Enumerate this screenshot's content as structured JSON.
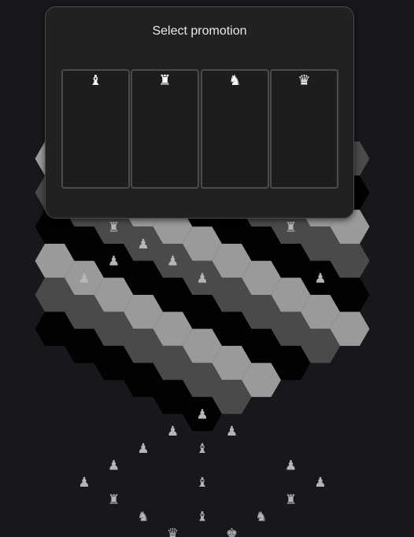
{
  "promotion": {
    "title": "Select promotion",
    "options": [
      {
        "piece": "bishop",
        "glyph": "♝"
      },
      {
        "piece": "rook",
        "glyph": "♜"
      },
      {
        "piece": "knight",
        "glyph": "♞"
      },
      {
        "piece": "queen",
        "glyph": "♛"
      }
    ]
  },
  "board": {
    "colors": {
      "light": "#9a9a9a",
      "mid": "#4a4a4a",
      "dark": "#020202"
    },
    "piece_color": "#b5b5b5",
    "pieces": [
      {
        "piece": "rook",
        "glyph": "♜",
        "col": -3,
        "row": -2
      },
      {
        "piece": "rook",
        "glyph": "♜",
        "col": 3,
        "row": -2
      },
      {
        "piece": "pawn",
        "glyph": "♟",
        "col": -4,
        "row": -1
      },
      {
        "piece": "bishop",
        "glyph": "♝",
        "col": 0,
        "row": -1
      },
      {
        "piece": "pawn",
        "glyph": "♟",
        "col": 4,
        "row": -1
      },
      {
        "piece": "pawn",
        "glyph": "♟",
        "col": -3,
        "row": -1
      },
      {
        "piece": "pawn",
        "glyph": "♟",
        "col": -2,
        "row": -1
      },
      {
        "piece": "pawn",
        "glyph": "♟",
        "col": -1,
        "row": 0
      },
      {
        "piece": "pawn",
        "glyph": "♟",
        "col": 0,
        "row": 1
      },
      {
        "piece": "pawn",
        "glyph": "♟",
        "col": 0,
        "row": 5
      },
      {
        "piece": "pawn",
        "glyph": "♟",
        "col": -1,
        "row": 5
      },
      {
        "piece": "pawn",
        "glyph": "♟",
        "col": 1,
        "row": 5
      },
      {
        "piece": "pawn",
        "glyph": "♟",
        "col": -2,
        "row": 5
      },
      {
        "piece": "pawn",
        "glyph": "♟",
        "col": -3,
        "row": 5
      },
      {
        "piece": "pawn",
        "glyph": "♟",
        "col": 3,
        "row": 5
      },
      {
        "piece": "pawn",
        "glyph": "♟",
        "col": -4,
        "row": 5
      },
      {
        "piece": "pawn",
        "glyph": "♟",
        "col": 4,
        "row": 5
      },
      {
        "piece": "rook",
        "glyph": "♜",
        "col": -3,
        "row": 6
      },
      {
        "piece": "rook",
        "glyph": "♜",
        "col": 3,
        "row": 6
      },
      {
        "piece": "bishop",
        "glyph": "♝",
        "col": 0,
        "row": 6
      },
      {
        "piece": "knight",
        "glyph": "♞",
        "col": -2,
        "row": 7
      },
      {
        "piece": "knight",
        "glyph": "♞",
        "col": 2,
        "row": 7
      },
      {
        "piece": "bishop",
        "glyph": "♝",
        "col": 0,
        "row": 7
      },
      {
        "piece": "queen",
        "glyph": "♛",
        "col": -1,
        "row": 8
      },
      {
        "piece": "king",
        "glyph": "♚",
        "col": 1,
        "row": 8
      },
      {
        "piece": "bishop",
        "glyph": "♝",
        "col": 0,
        "row": 8
      }
    ]
  }
}
